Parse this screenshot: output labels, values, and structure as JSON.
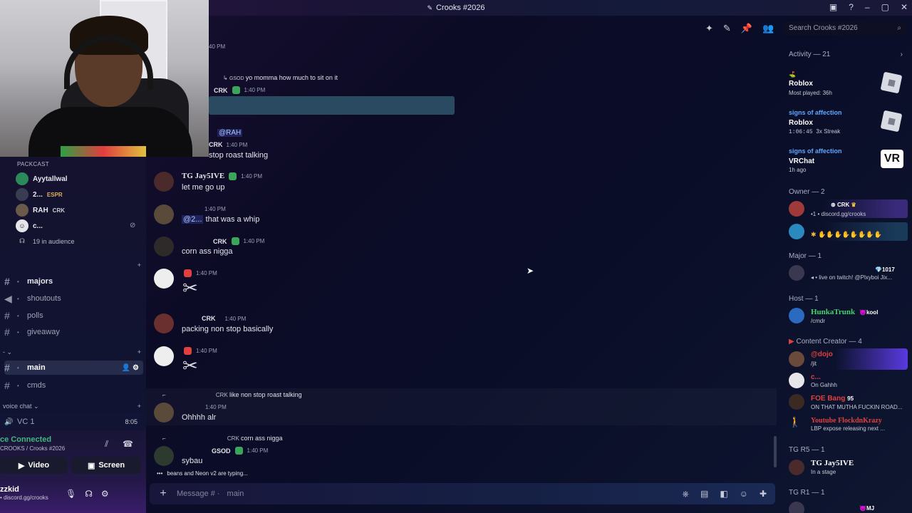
{
  "window": {
    "title": "Crooks #2026"
  },
  "header": {
    "search_placeholder": "Search Crooks #2026"
  },
  "voice_area": {
    "category": "PACKCAST",
    "users": [
      {
        "name": "Ayytallwal",
        "tag": ""
      },
      {
        "name": "2...",
        "tag": "ESPR"
      },
      {
        "name": "RAH",
        "tag": "CRK"
      },
      {
        "name": "c...",
        "tag": ""
      }
    ],
    "audience": "19 in audience"
  },
  "channels_a": [
    {
      "label": "majors",
      "bold": true
    },
    {
      "label": "shoutouts"
    },
    {
      "label": "polls"
    },
    {
      "label": "giveaway"
    }
  ],
  "channels_b": [
    {
      "label": "main",
      "active": true
    },
    {
      "label": "cmds"
    }
  ],
  "voice_category": "voice chat",
  "voice_channel": {
    "name": "VC 1",
    "time": "8:05"
  },
  "vc_panel": {
    "status": "ce Connected",
    "location": "CROOKS / Crooks #2026",
    "video_label": "Video",
    "screen_label": "Screen",
    "user_name": "zzkid",
    "user_sub": "• discord.gg/crooks"
  },
  "messages": {
    "m0_time": "40 PM",
    "reply1": {
      "name": "GSOD",
      "text": "yo momma how much to sit on it"
    },
    "m1": {
      "tag": "CRK",
      "time": "1:40 PM"
    },
    "m2": {
      "mention": "@RAH",
      "tag": "CRK",
      "time": "1:40 PM",
      "text": "stop roast talking"
    },
    "m3": {
      "name": "TG Jay5IVE",
      "time": "1:40 PM",
      "text": "let me go up"
    },
    "m4": {
      "time": "1:40 PM",
      "mention": "@2...",
      "text": "that was a whip"
    },
    "m5": {
      "tag": "CRK",
      "time": "1:40 PM",
      "text": "corn ass nigga"
    },
    "m6": {
      "time": "1:40 PM"
    },
    "m7": {
      "tag": "CRK",
      "time": "1:40 PM",
      "text": "packing non stop basically"
    },
    "m8": {
      "time": "1:40 PM"
    },
    "m9": {
      "reply_tag": "CRK",
      "reply_text": "like non stop roast talking",
      "time": "1:40 PM",
      "text": "Ohhhh alr"
    },
    "m10": {
      "reply_tag": "CRK",
      "reply_text": "corn ass nigga",
      "tag": "GSOD",
      "time": "1:40 PM",
      "text": "sybau"
    },
    "typing": "beans and Neon v2 are typing..."
  },
  "input": {
    "placeholder": "Message # ·",
    "channel": "main"
  },
  "activity": {
    "header": "Activity — 21",
    "items": [
      {
        "user": "",
        "game": "Roblox",
        "sub": "Most played: 36h"
      },
      {
        "user": "signs of affection",
        "game": "Roblox",
        "sub": "1:06:45",
        "extra": "3x Streak"
      },
      {
        "user": "signs of affection",
        "game": "VRChat",
        "sub": "1h ago"
      }
    ]
  },
  "groups": {
    "owner": "Owner — 2",
    "major": "Major — 1",
    "host": "Host — 1",
    "creator": "Content Creator — 4",
    "tgr5": "TG R5 — 1",
    "tgr1": "TG R1 — 1"
  },
  "members": {
    "owner1": {
      "tag": "CRK",
      "sub": "•1 • discord.gg/crooks"
    },
    "major1": {
      "count": "1017",
      "sub": "live on twitch! @Plxyboi Jix..."
    },
    "host1": {
      "name": "HunkaTrunk",
      "tag": "kool",
      "sub": "/cmdr"
    },
    "cc1": {
      "name": "@dojo",
      "sub": "/jit"
    },
    "cc2": {
      "name": "c...",
      "sub": "On Gahhh"
    },
    "cc3": {
      "name": "FOE Bang",
      "count": "95",
      "sub": "ON THAT MUTHA FUCKIN ROAD..."
    },
    "cc4": {
      "name": "Youtube FlockdnKrazy",
      "sub": "LBP expose releasing next ..."
    },
    "tg1": {
      "name": "TG Jay5IVE",
      "sub": "In a stage"
    },
    "tgr1_1": {
      "tag": "MJ"
    }
  },
  "colors": {
    "accent_blue": "#5ea8ff",
    "accent_green": "#3ba55c",
    "accent_red": "#e0403e"
  }
}
